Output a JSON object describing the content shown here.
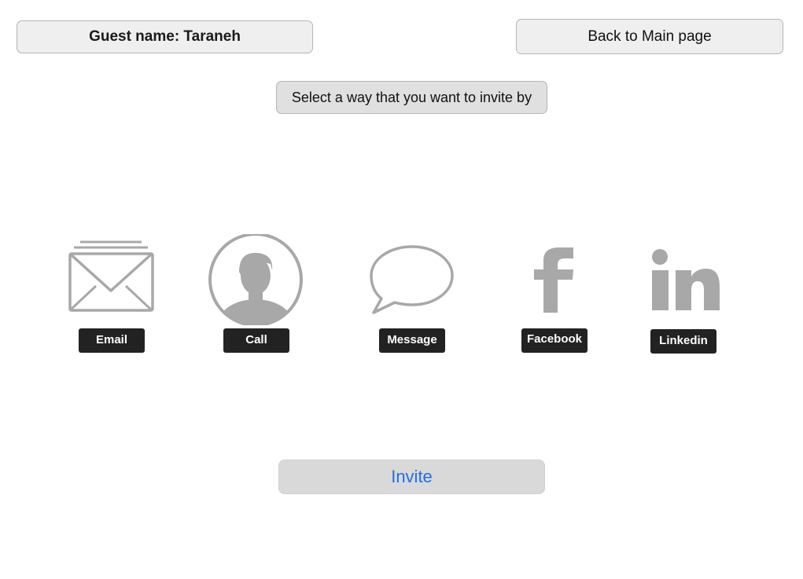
{
  "guest": {
    "label": "Guest name: Taraneh"
  },
  "header": {
    "back_label": "Back to Main page"
  },
  "prompt": {
    "text": "Select a way that you want to invite by"
  },
  "options": [
    {
      "label": "Email",
      "icon": "envelope-icon"
    },
    {
      "label": "Call",
      "icon": "person-icon"
    },
    {
      "label": "Message",
      "icon": "speech-bubble-icon"
    },
    {
      "label": "Facebook",
      "icon": "facebook-icon"
    },
    {
      "label": "Linkedin",
      "icon": "linkedin-icon"
    }
  ],
  "footer": {
    "invite_label": "Invite"
  },
  "colors": {
    "icon_gray": "#a8a8a8",
    "label_bg": "#222222",
    "invite_text": "#1f6fe5"
  }
}
